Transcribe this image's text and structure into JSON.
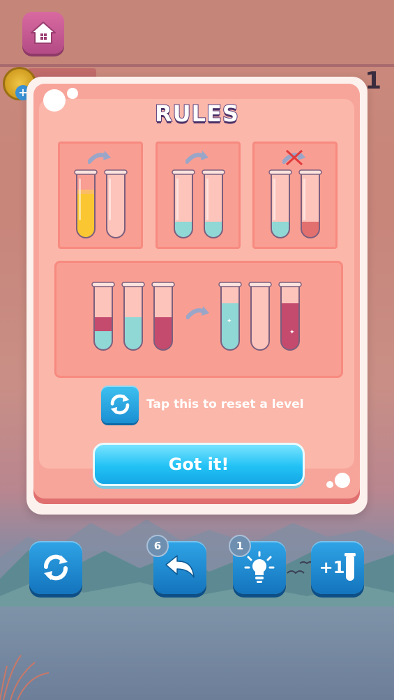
{
  "header": {
    "home_icon": "home-icon",
    "coin_icon": "coin-icon",
    "coin_plus": "+",
    "level_number": "1"
  },
  "dialog": {
    "title": "RULES",
    "reset_hint": "Tap this to reset a level",
    "confirm_label": "Got it!",
    "reset_icon": "refresh-icon",
    "rules": [
      {
        "arrow": "arrow-icon",
        "tubes": [
          "yellow-full",
          "empty"
        ]
      },
      {
        "arrow": "arrow-icon",
        "tubes": [
          "cyan-low",
          "cyan-low"
        ]
      },
      {
        "arrow": "crossed-arrow-icon",
        "tubes": [
          "cyan-low",
          "red-low"
        ]
      }
    ]
  },
  "toolbar": {
    "reset_icon": "refresh-icon",
    "undo_icon": "undo-icon",
    "undo_count": "6",
    "hint_icon": "lightbulb-icon",
    "hint_count": "1",
    "add_tube_icon": "add-tube-icon",
    "add_tube_label": "+1"
  },
  "colors": {
    "yellow": "#f7b90f",
    "cyan": "#8fd8d6",
    "red": "#e2706e",
    "plum": "#c44a6e",
    "button_blue": "#1e8fd6",
    "dialog_pink": "#f7a59b"
  }
}
